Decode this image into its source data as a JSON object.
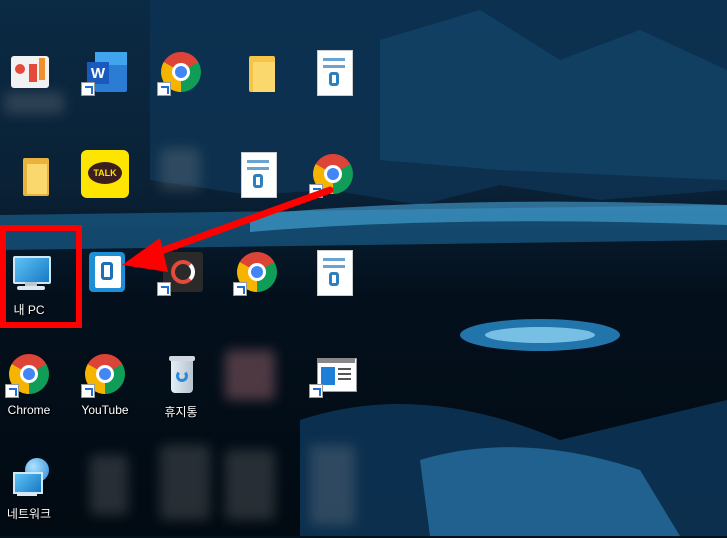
{
  "desktop": {
    "icons": {
      "my_pc": "내 PC",
      "chrome": "Chrome",
      "youtube": "YouTube",
      "recycle_bin": "휴지통",
      "network": "네트워크"
    },
    "kakao_badge": "TALK",
    "word_badge": "W"
  },
  "annotation": {
    "box_color": "#ff0000",
    "arrow_color": "#ff0000"
  }
}
